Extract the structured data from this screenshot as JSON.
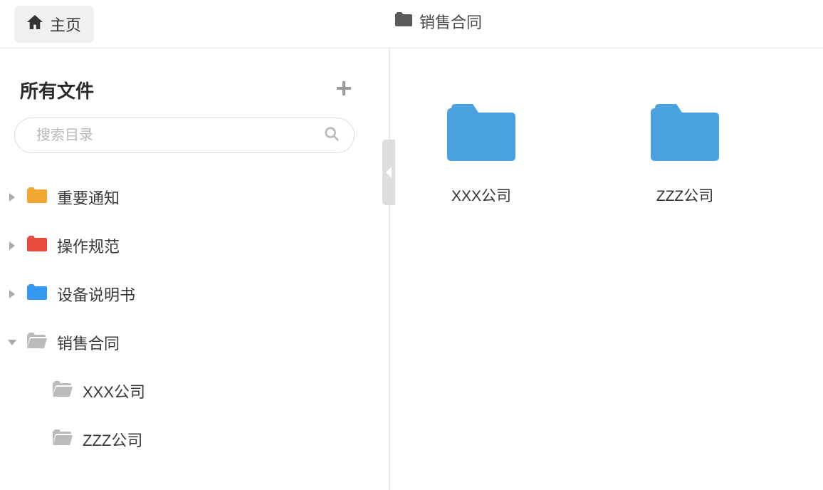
{
  "header": {
    "home_label": "主页",
    "breadcrumb_label": "销售合同"
  },
  "sidebar": {
    "title": "所有文件",
    "search_placeholder": "搜索目录",
    "tree": [
      {
        "label": "重要通知",
        "color": "#f0a832",
        "expanded": false,
        "children": []
      },
      {
        "label": "操作规范",
        "color": "#e84c3d",
        "expanded": false,
        "children": []
      },
      {
        "label": "设备说明书",
        "color": "#3498f0",
        "expanded": false,
        "children": []
      },
      {
        "label": "销售合同",
        "color": "#bbbbbb",
        "expanded": true,
        "open": true,
        "children": [
          {
            "label": "XXX公司",
            "color": "#bbbbbb",
            "open": true
          },
          {
            "label": "ZZZ公司",
            "color": "#bbbbbb",
            "open": true
          }
        ]
      }
    ]
  },
  "content": {
    "folders": [
      {
        "label": "XXX公司"
      },
      {
        "label": "ZZZ公司"
      }
    ]
  },
  "colors": {
    "folder_blue": "#4aa3df"
  }
}
